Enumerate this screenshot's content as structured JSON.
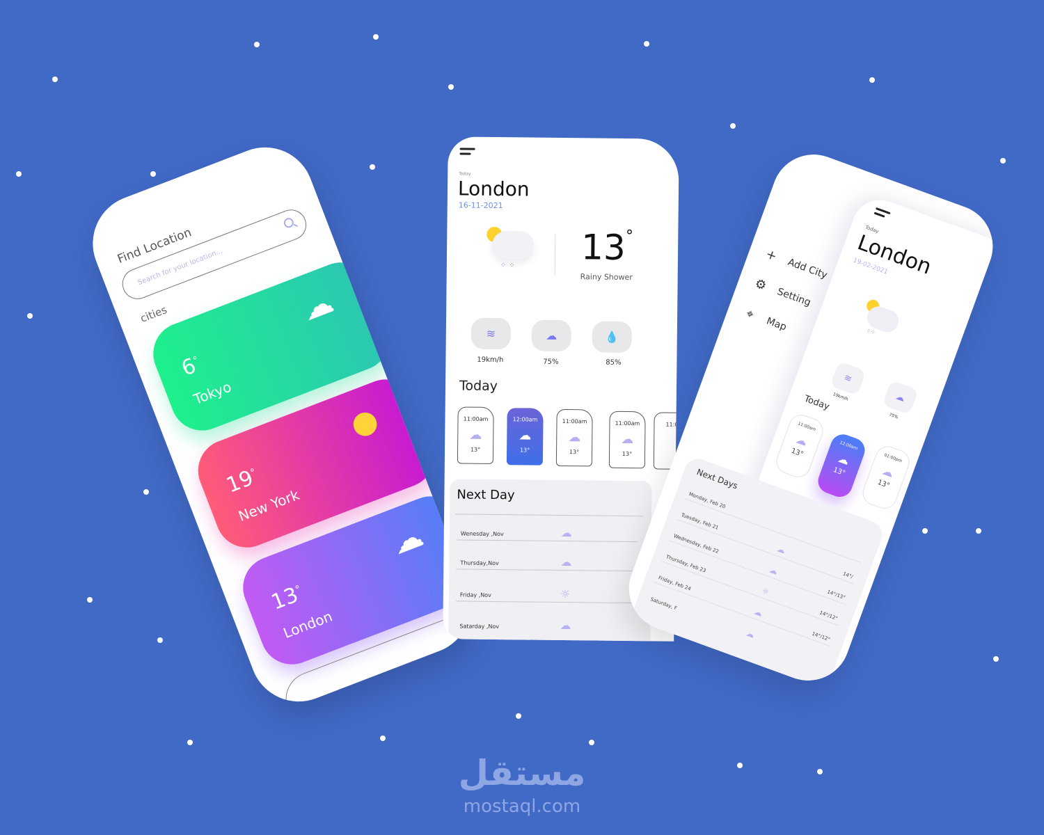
{
  "colors": {
    "background": "#4169c6",
    "accent": "#6a8ee8",
    "tokyo": [
      "#1ee88e",
      "#2bc8b0"
    ],
    "new_york": [
      "#ff5f7a",
      "#c417d6"
    ],
    "london": [
      "#c45bf2",
      "#4f7ef7"
    ]
  },
  "city_list": {
    "title": "Find Location",
    "search_placeholder": "Search for your location...",
    "section": "cities",
    "cities": [
      {
        "temp": "6",
        "name": "Tokyo",
        "icon": "cloud-lightning-icon"
      },
      {
        "temp": "19",
        "name": "New York",
        "icon": "sun-wind-icon"
      },
      {
        "temp": "13",
        "name": "London",
        "icon": "sun-cloud-rain-icon"
      }
    ],
    "add_city": "Add City"
  },
  "main": {
    "today_label": "Today",
    "city": "London",
    "date": "16-11-2021",
    "temp": "13",
    "degree": "°",
    "condition": "Rainy Shower",
    "stats": [
      {
        "icon": "wind-icon",
        "value": "19km/h"
      },
      {
        "icon": "cloud-icon",
        "value": "75%"
      },
      {
        "icon": "humidity-drop-icon",
        "value": "85%"
      }
    ],
    "today": "Today",
    "hours": [
      {
        "time": "11:00am",
        "temp": "13°",
        "icon": "storm-icon"
      },
      {
        "time": "12:00am",
        "temp": "13°",
        "icon": "sun-cloud-icon",
        "active": true
      },
      {
        "time": "11:00am",
        "temp": "13°",
        "icon": "sun-cloud-rain-icon"
      },
      {
        "time": "11:00am",
        "temp": "13°",
        "icon": "cloud-icon"
      },
      {
        "time": "11:0"
      }
    ],
    "next_title": "Next Day",
    "next": [
      {
        "day": "Wenesday ,Nov",
        "icon": "sun-cloud-rain-icon"
      },
      {
        "day": "Thursday,Nov",
        "icon": "cloud-icon"
      },
      {
        "day": "Friday ,Nov",
        "icon": "sun-icon"
      },
      {
        "day": "Satarday ,Nov",
        "icon": "sun-cloud-rain-icon"
      }
    ]
  },
  "drawer": {
    "menu": [
      {
        "icon": "plus-icon",
        "label": "Add City"
      },
      {
        "icon": "gear-icon",
        "label": "Setting"
      },
      {
        "icon": "map-pin-icon",
        "label": "Map"
      }
    ],
    "today_label": "Today",
    "city": "London",
    "date": "19-02-2021",
    "stats": [
      {
        "value": "19km/h"
      },
      {
        "value": "75%"
      }
    ],
    "today": "Today",
    "hours": [
      {
        "time": "11:00am",
        "temp": "13°"
      },
      {
        "time": "12:00am",
        "temp": "13°",
        "active": true
      },
      {
        "time": "01:00pm",
        "temp": "13°"
      }
    ],
    "next_title": "Next Days",
    "next": [
      {
        "day": "Monday, Feb 20",
        "temp": ""
      },
      {
        "day": "Tuesday, Feb 21",
        "temp": "14°/"
      },
      {
        "day": "Wednesday, Feb 22",
        "temp": "14°/13°"
      },
      {
        "day": "Thursday, Feb 23",
        "temp": "14°/12°"
      },
      {
        "day": "Friday, Feb 24",
        "temp": "14°/12°"
      },
      {
        "day": "Saturday, F",
        "temp": ""
      }
    ]
  },
  "watermark": {
    "arabic": "مستقل",
    "latin": "mostaql.com"
  }
}
